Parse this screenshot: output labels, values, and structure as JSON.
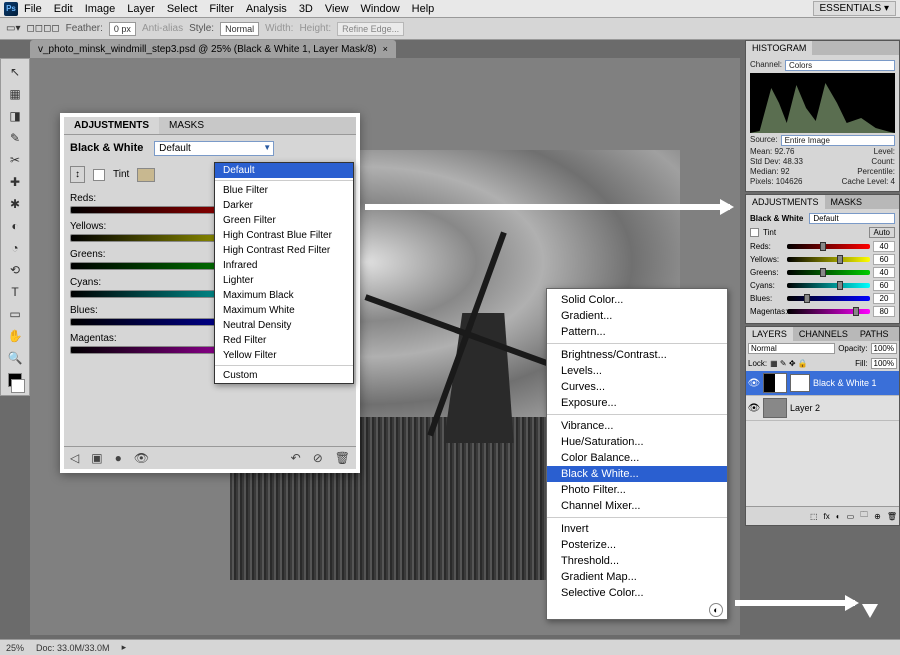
{
  "menu": {
    "items": [
      "File",
      "Edit",
      "Image",
      "Layer",
      "Select",
      "Filter",
      "Analysis",
      "3D",
      "View",
      "Window",
      "Help"
    ],
    "ps": "Ps",
    "essentials": "ESSENTIALS ▾"
  },
  "options": {
    "feather_lbl": "Feather:",
    "feather_val": "0 px",
    "antialias": "Anti-alias",
    "style_lbl": "Style:",
    "style_val": "Normal",
    "width_lbl": "Width:",
    "height_lbl": "Height:",
    "refine": "Refine Edge...",
    "zoom": "25% ▾"
  },
  "doctab": {
    "title": "v_photo_minsk_windmill_step3.psd @ 25% (Black & White 1, Layer Mask/8)",
    "close": "×"
  },
  "tools": [
    "↖",
    "▦",
    "◨",
    "✎",
    "✂",
    "✚",
    "✱",
    "◐",
    "◔",
    "⟲",
    "T",
    "▭",
    "✋",
    "🔍"
  ],
  "adjustments": {
    "tab_adj": "ADJUSTMENTS",
    "tab_masks": "MASKS",
    "title": "Black & White",
    "preset": "Default",
    "hand": "↕",
    "tint": "Tint",
    "auto": "Auto",
    "sliders": [
      "Reds:",
      "Yellows:",
      "Greens:",
      "Cyans:",
      "Blues:",
      "Magentas:"
    ],
    "footer_icons": [
      "◁",
      "▣",
      "●",
      "👁",
      "↶",
      "⊘",
      "🗑"
    ]
  },
  "preset_list": [
    "Default",
    "Blue Filter",
    "Darker",
    "Green Filter",
    "High Contrast Blue Filter",
    "High Contrast Red Filter",
    "Infrared",
    "Lighter",
    "Maximum Black",
    "Maximum White",
    "Neutral Density",
    "Red Filter",
    "Yellow Filter",
    "Custom"
  ],
  "ctx_menu": {
    "g1": [
      "Solid Color...",
      "Gradient...",
      "Pattern..."
    ],
    "g2": [
      "Brightness/Contrast...",
      "Levels...",
      "Curves...",
      "Exposure..."
    ],
    "g3": [
      "Vibrance...",
      "Hue/Saturation...",
      "Color Balance...",
      "Black & White...",
      "Photo Filter...",
      "Channel Mixer..."
    ],
    "g4": [
      "Invert",
      "Posterize...",
      "Threshold...",
      "Gradient Map...",
      "Selective Color..."
    ],
    "highlight": "Black & White...",
    "handle": "◐"
  },
  "histogram": {
    "tab": "HISTOGRAM",
    "channel_lbl": "Channel:",
    "channel_val": "Colors",
    "source_lbl": "Source:",
    "source_val": "Entire Image",
    "stats": [
      {
        "l": "Mean:",
        "v": "92.76",
        "l2": "Level:"
      },
      {
        "l": "Std Dev:",
        "v": "48.33",
        "l2": "Count:"
      },
      {
        "l": "Median:",
        "v": "92",
        "l2": "Percentile:"
      },
      {
        "l": "Pixels:",
        "v": "104626",
        "l2": "Cache Level:",
        "v2": "4"
      }
    ]
  },
  "mini_adj": {
    "tab_adj": "ADJUSTMENTS",
    "tab_masks": "MASKS",
    "title": "Black & White",
    "preset": "Default",
    "tint": "Tint",
    "auto": "Auto",
    "rows": [
      {
        "name": "Reds:",
        "val": "40",
        "pct": 40,
        "grad": "grad-reds"
      },
      {
        "name": "Yellows:",
        "val": "60",
        "pct": 60,
        "grad": "grad-yellows"
      },
      {
        "name": "Greens:",
        "val": "40",
        "pct": 40,
        "grad": "grad-greens"
      },
      {
        "name": "Cyans:",
        "val": "60",
        "pct": 60,
        "grad": "grad-cyans"
      },
      {
        "name": "Blues:",
        "val": "20",
        "pct": 20,
        "grad": "grad-blues"
      },
      {
        "name": "Magentas:",
        "val": "80",
        "pct": 80,
        "grad": "grad-magentas"
      }
    ]
  },
  "layers": {
    "tabs": [
      "LAYERS",
      "CHANNELS",
      "PATHS"
    ],
    "blend_lbl": "Normal",
    "opacity_lbl": "Opacity:",
    "opacity_val": "100%",
    "lock_lbl": "Lock:",
    "fill_lbl": "Fill:",
    "fill_val": "100%",
    "items": [
      {
        "name": "Black & White 1",
        "sel": true,
        "bw": true
      },
      {
        "name": "Layer 2",
        "sel": false,
        "bw": false
      }
    ],
    "footer": [
      "⬚",
      "fx",
      "◐",
      "▭",
      "🗀",
      "⊕",
      "🗑"
    ]
  },
  "status": {
    "zoom": "25%",
    "doc": "Doc: 33.0M/33.0M"
  }
}
